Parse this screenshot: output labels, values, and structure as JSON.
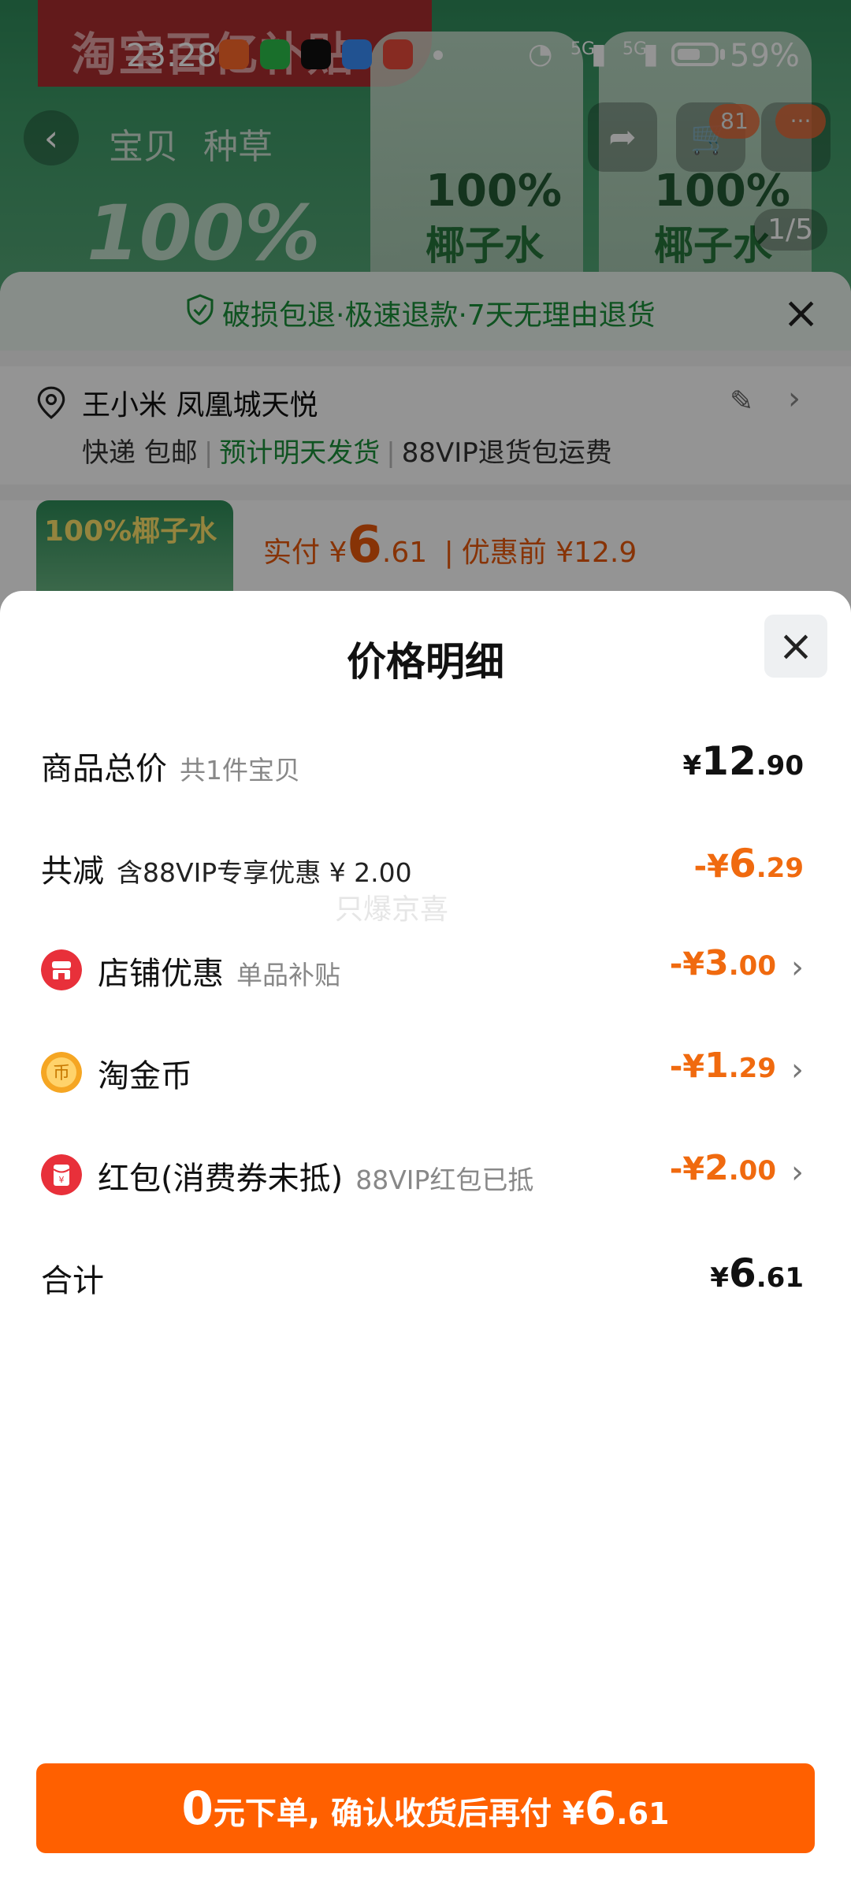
{
  "status_bar": {
    "time": "23:28",
    "battery": "59%",
    "net1": "5G",
    "net2": "5G"
  },
  "background": {
    "banner": "淘宝百亿补贴",
    "tabs": [
      "宝贝",
      "种草"
    ],
    "cart_badge": "81",
    "more_badge": "···",
    "image_counter": "1/5",
    "hero_text": "100%",
    "bottle_pct": "100%",
    "bottle_name": "椰子水"
  },
  "order": {
    "guarantee": "破损包退·极速退款·7天无理由退货",
    "address": "王小米 凤凰城天悦",
    "ship_method": "快递 包邮",
    "ship_eta": "预计明天发货",
    "ship_extra": "88VIP退货包运费",
    "goods_img_text": "100%椰子水",
    "price_prefix": "实付 ¥",
    "price_big": "6",
    "price_dec": ".61",
    "price_before": "优惠前 ¥12.9"
  },
  "modal": {
    "title": "价格明细",
    "rows": [
      {
        "label": "商品总价",
        "sub": "共1件宝贝",
        "sign": "",
        "int": "12",
        "dec": ".90",
        "color": "#111111"
      },
      {
        "label": "共减",
        "sub": "含88VIP专享优惠 ¥ 2.00",
        "sign": "-¥",
        "int": "6",
        "dec": ".29",
        "color": "#f06a0f"
      },
      {
        "label": "店铺优惠",
        "sub": "单品补贴",
        "sign": "-¥",
        "int": "3",
        "dec": ".00",
        "color": "#f06a0f"
      },
      {
        "label": "淘金币",
        "sub": "",
        "sign": "-¥",
        "int": "1",
        "dec": ".29",
        "color": "#f06a0f"
      },
      {
        "label": "红包(消费券未抵)",
        "sub": "88VIP红包已抵",
        "sign": "-¥",
        "int": "2",
        "dec": ".00",
        "color": "#f06a0f"
      },
      {
        "label": "合计",
        "sub": "",
        "sign": "¥",
        "int": "6",
        "dec": ".61",
        "color": "#111111"
      }
    ],
    "watermark": "只爆京喜",
    "cta": {
      "big": "0",
      "text": "元下单, 确认收货后再付 ¥",
      "amount_int": "6",
      "amount_dec": ".61"
    }
  },
  "icons": {
    "store": "store-icon",
    "coin": "coin-icon",
    "red_packet": "red-packet-icon",
    "close": "close-icon",
    "chevron": "chevron-right-icon"
  },
  "colors": {
    "accent": "#ff6000",
    "discount": "#f06a0f",
    "green": "#1b8f3a"
  }
}
